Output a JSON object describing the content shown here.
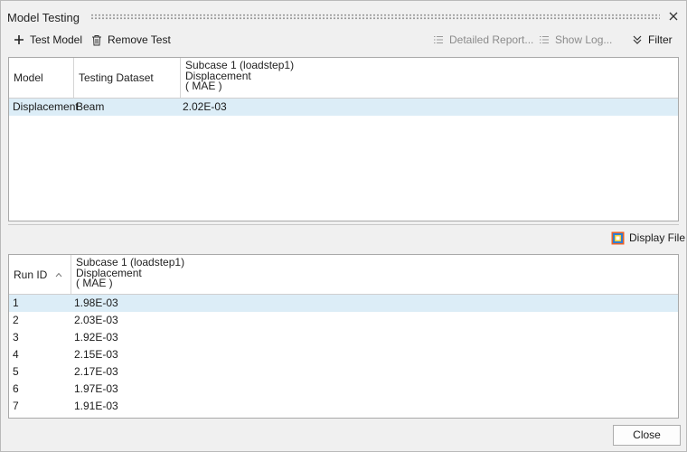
{
  "window": {
    "title": "Model Testing"
  },
  "toolbar": {
    "test_model": "Test Model",
    "remove_test": "Remove Test",
    "detailed_report": "Detailed Report...",
    "show_log": "Show Log...",
    "filter": "Filter"
  },
  "top_table": {
    "headers": {
      "model": "Model",
      "dataset": "Testing Dataset",
      "subcase": {
        "line1": "Subcase 1 (loadstep1)",
        "line2": "Displacement",
        "line3": "( MAE )"
      }
    },
    "rows": [
      {
        "model": "Displacement",
        "dataset": "Beam",
        "value": "2.02E-03",
        "selected": true
      }
    ]
  },
  "display_file": {
    "label": "Display File"
  },
  "bottom_table": {
    "headers": {
      "run_id": "Run ID",
      "subcase": {
        "line1": "Subcase 1 (loadstep1)",
        "line2": "Displacement",
        "line3": "( MAE )"
      }
    },
    "sort": "ascending",
    "rows": [
      {
        "id": "1",
        "value": "1.98E-03",
        "selected": true
      },
      {
        "id": "2",
        "value": "2.03E-03"
      },
      {
        "id": "3",
        "value": "1.92E-03"
      },
      {
        "id": "4",
        "value": "2.15E-03"
      },
      {
        "id": "5",
        "value": "2.17E-03"
      },
      {
        "id": "6",
        "value": "1.97E-03"
      },
      {
        "id": "7",
        "value": "1.91E-03"
      }
    ]
  },
  "footer": {
    "close": "Close"
  },
  "colors": {
    "selection": "#dcedf7",
    "disabled_text": "#8b8b8b",
    "border": "#a9a9a9"
  }
}
